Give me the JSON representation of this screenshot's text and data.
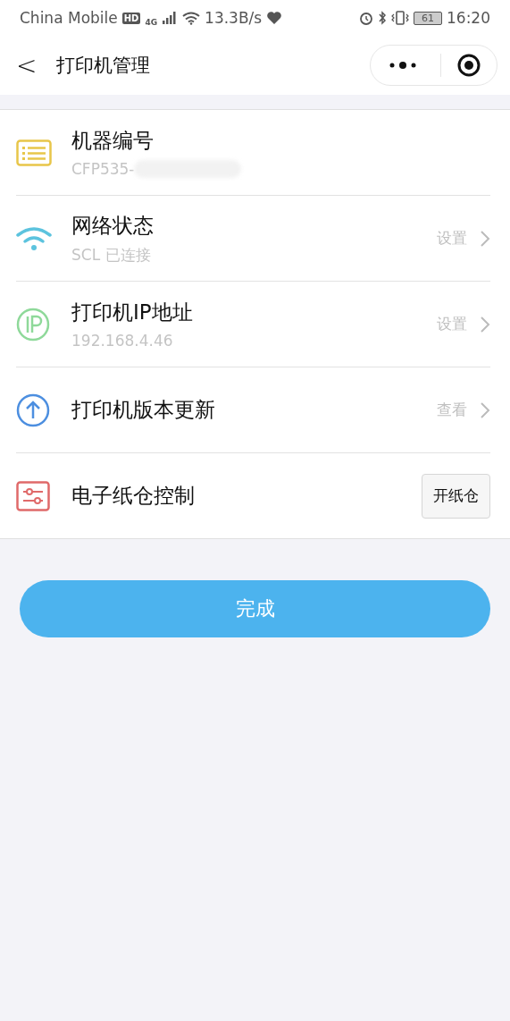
{
  "status_bar": {
    "carrier": "China Mobile",
    "hd_badge": "HD",
    "network": "4G",
    "speed": "13.3B/s",
    "battery": "61",
    "time": "16:20"
  },
  "nav": {
    "back": "<",
    "title": "打印机管理"
  },
  "items": [
    {
      "kind": "info",
      "title": "机器编号",
      "subtitle": "CFP535-",
      "redacted": true
    },
    {
      "kind": "link",
      "title": "网络状态",
      "subtitle": "SCL 已连接",
      "action": "设置"
    },
    {
      "kind": "link",
      "title": "打印机IP地址",
      "subtitle": "192.168.4.46",
      "action": "设置"
    },
    {
      "kind": "link",
      "title": "打印机版本更新",
      "action": "查看"
    },
    {
      "kind": "button",
      "title": "电子纸仓控制",
      "button": "开纸仓"
    }
  ],
  "done_button": "完成"
}
